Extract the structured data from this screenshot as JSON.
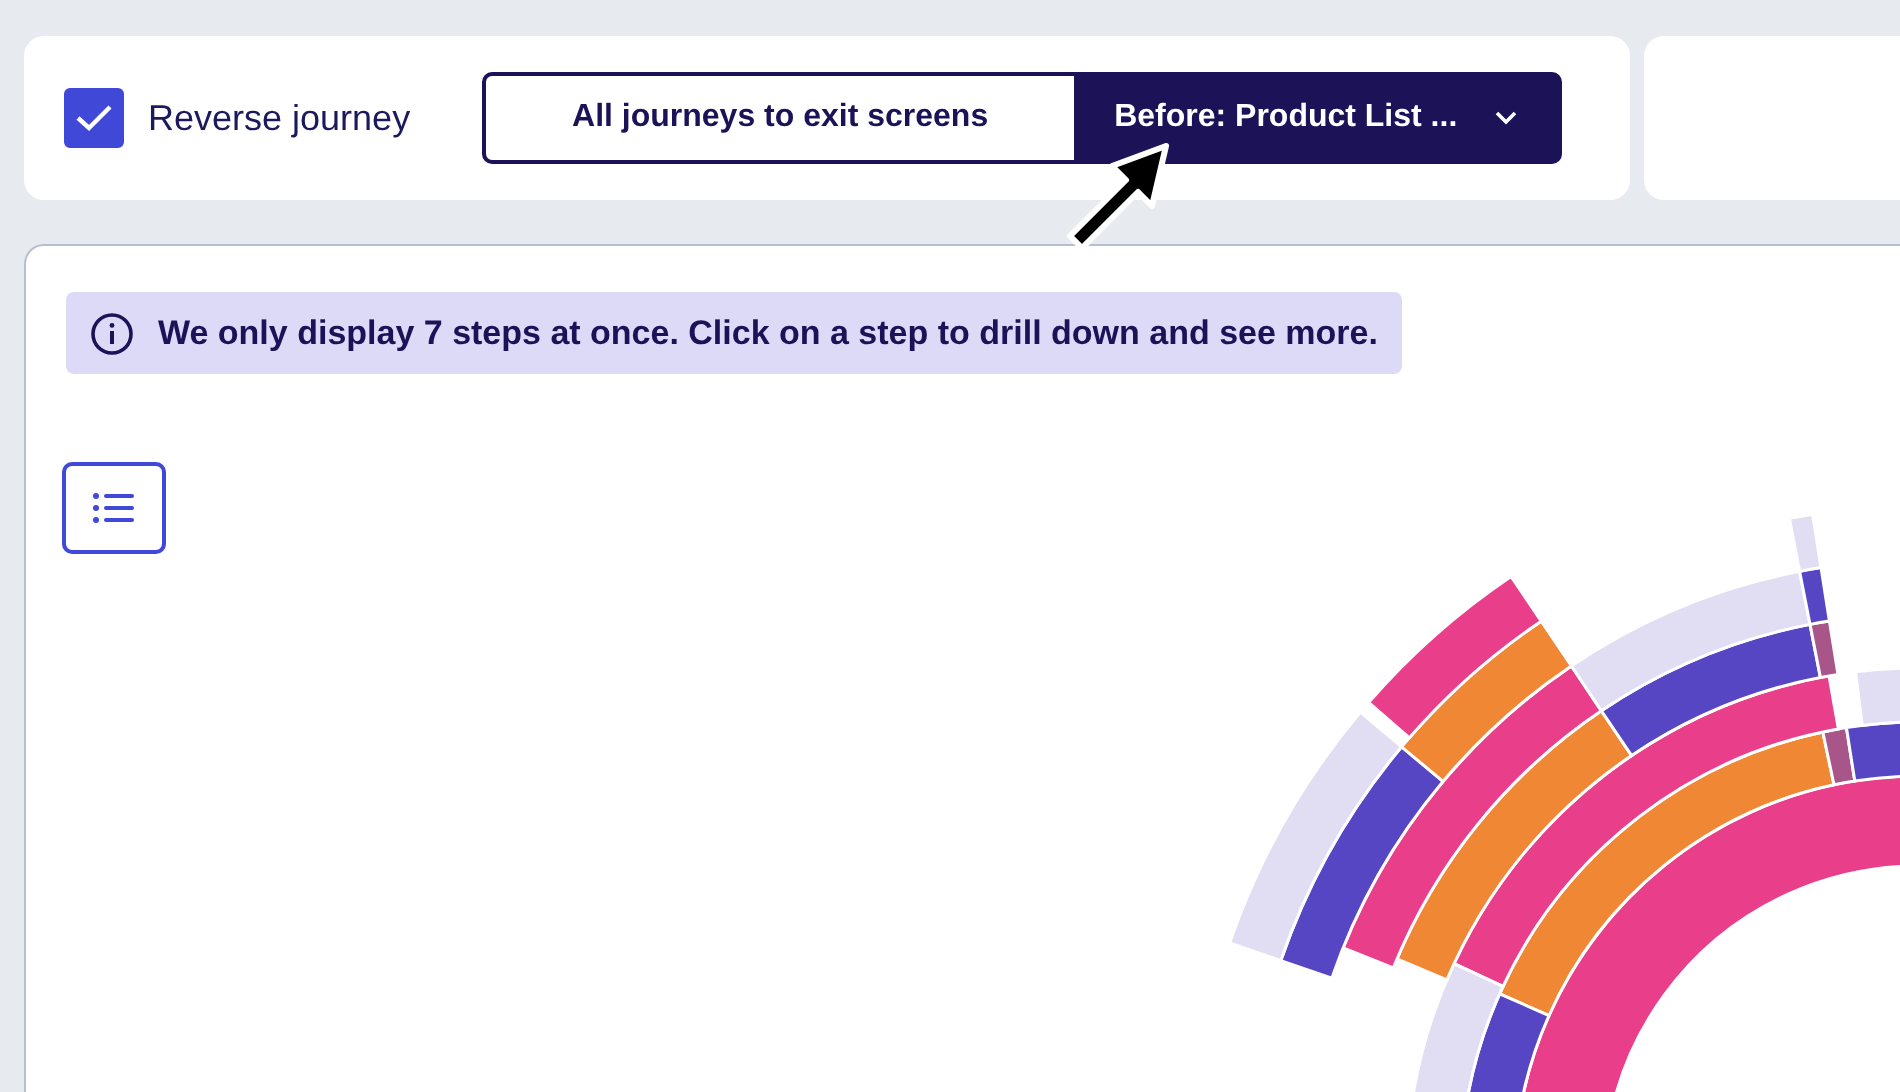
{
  "toolbar": {
    "reverse_journey": {
      "label": "Reverse journey",
      "checked": true
    },
    "journey_modes": [
      {
        "label": "All journeys to exit screens",
        "selected": false,
        "kind": "button"
      },
      {
        "label": "Before: Product List ...",
        "selected": true,
        "kind": "dropdown"
      }
    ]
  },
  "info_banner": {
    "text": "We only display 7 steps at once. Click on a step to drill down and see more."
  }
}
